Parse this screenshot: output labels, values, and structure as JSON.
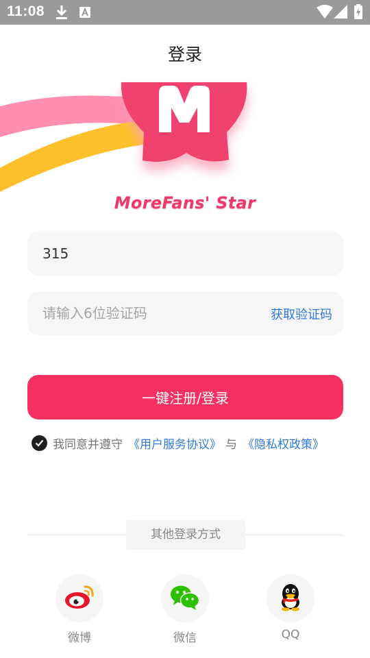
{
  "status_bar": {
    "time": "11:08",
    "icons": [
      "download-icon",
      "font-icon",
      "wifi-icon",
      "signal-icon",
      "battery-charging-icon"
    ]
  },
  "header": {
    "title": "登录"
  },
  "brand": {
    "logo_letter": "M",
    "name": "MoreFans' Star"
  },
  "form": {
    "phone_value": "315",
    "code_placeholder": "请输入6位验证码",
    "get_code_label": "获取验证码",
    "submit_label": "一键注册/登录"
  },
  "agreement": {
    "checked": true,
    "prefix": "我同意并遵守",
    "user_agreement": "《用户服务协议》",
    "and": "与",
    "privacy_policy": "《隐私权政策》"
  },
  "other_login": {
    "label": "其他登录方式",
    "options": [
      {
        "label": "微博",
        "icon": "weibo-icon"
      },
      {
        "label": "微信",
        "icon": "wechat-icon"
      },
      {
        "label": "QQ",
        "icon": "qq-icon"
      }
    ]
  },
  "colors": {
    "accent": "#f53162",
    "link": "#2f7ad8",
    "status_bar": "#9a9a9a",
    "field_bg": "#f6f6f8",
    "logo_pink": "#f1416f",
    "ribbon_pink": "#ff8fb0",
    "ribbon_yellow": "#ffc12b"
  }
}
